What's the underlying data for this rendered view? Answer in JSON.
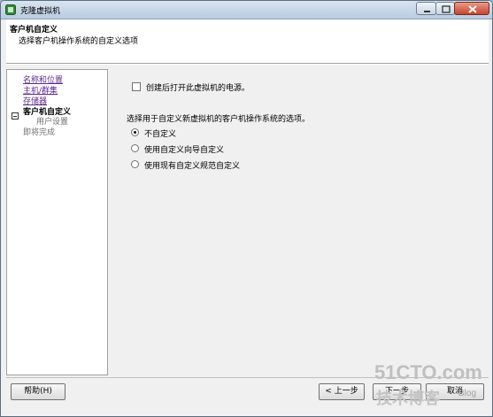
{
  "window": {
    "title": "克隆虚拟机"
  },
  "header": {
    "title": "客户机自定义",
    "subtitle": "选择客户机操作系统的自定义选项"
  },
  "nav": {
    "items": [
      {
        "label": "名称和位置",
        "state": "link"
      },
      {
        "label": "主机/群集",
        "state": "link"
      },
      {
        "label": "存储器",
        "state": "link"
      },
      {
        "label": "客户机自定义",
        "state": "current"
      },
      {
        "label": "用户设置",
        "state": "sub"
      },
      {
        "label": "即将完成",
        "state": "pending"
      }
    ]
  },
  "main": {
    "power_on_label": "创建后打开此虚拟机的电源。",
    "power_on_checked": false,
    "question": "选择用于自定义新虚拟机的客户机操作系统的选项。",
    "options": [
      {
        "label": "不自定义",
        "selected": true
      },
      {
        "label": "使用自定义向导自定义",
        "selected": false
      },
      {
        "label": "使用现有自定义规范自定义",
        "selected": false
      }
    ]
  },
  "footer": {
    "help_label": "帮助(H)",
    "back_label": "< 上一步",
    "next_label": "下一步",
    "cancel_label": "取消"
  },
  "watermark": {
    "site": "51CTO.com",
    "tagline": "技术博客",
    "blog": "Blog"
  }
}
